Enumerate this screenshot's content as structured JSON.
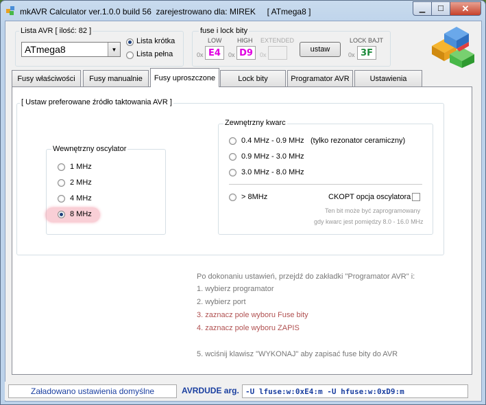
{
  "window": {
    "title": "mkAVR Calculator ver.1.0.0 build 56  zarejestrowano dla: MIREK     [ ATmega8 ]",
    "min_glyph": "▁",
    "max_glyph": "☐",
    "close_glyph": "✕"
  },
  "avr_list": {
    "group_label": "Lista AVR [ ilość: 82 ]",
    "selected": "ATmega8",
    "radio_short": "Lista krótka",
    "radio_full": "Lista pełna"
  },
  "fuse": {
    "group_label": "fuse i lock bity",
    "low_label": "LOW",
    "high_label": "HIGH",
    "extended_label": "EXTENDED",
    "lock_label": "LOCK BAJT",
    "prefix": "0x",
    "low_value": "E4",
    "high_value": "D9",
    "extended_value": "",
    "lock_value": "3F",
    "button_label": "ustaw",
    "low_color": "#e000e0",
    "high_color": "#e000e0",
    "lock_color": "#1c8a3a"
  },
  "tabs": [
    {
      "label": "Fusy właściwości"
    },
    {
      "label": "Fusy manualnie"
    },
    {
      "label": "Fusy uproszczone"
    },
    {
      "label": "Lock bity"
    },
    {
      "label": "Programator AVR"
    },
    {
      "label": "Ustawienia"
    }
  ],
  "panel": {
    "group_label": "[ Ustaw preferowane źródło taktowania AVR ]",
    "internal": {
      "label": "Wewnętrzny oscylator",
      "options": [
        "1 MHz",
        "2 MHz",
        "4 MHz",
        "8 MHz"
      ],
      "selected_index": 3
    },
    "external": {
      "label": "Zewnętrzny kwarc",
      "opt1": "0.4 MHz - 0.9 MHz",
      "opt1_note": "(tylko rezonator ceramiczny)",
      "opt2": "0.9 MHz - 3.0 MHz",
      "opt3": "3.0 MHz - 8.0 MHz",
      "opt4": "> 8MHz",
      "ckopt_label": "CKOPT opcja oscylatora",
      "note_line1": "Ten bit może być zaprogramowany",
      "note_line2": "gdy kwarc jest pomiędzy 8.0 - 16.0 MHz"
    },
    "instructions": {
      "intro": "Po dokonaniu ustawień, przejdź do zakładki \"Programator AVR\" i:",
      "step1": "1. wybierz programator",
      "step2": "2. wybierz port",
      "step3": "3. zaznacz pole wyboru Fuse bity",
      "step4": "4. zaznacz pole wyboru ZAPIS",
      "step5": "5. wciśnij klawisz \"WYKONAJ\" aby zapisać fuse bity do AVR"
    }
  },
  "status": {
    "message": "Załadowano ustawienia domyślne",
    "avrdude_label": "AVRDUDE arg.",
    "avrdude_value": "-U lfuse:w:0xE4:m  -U hfuse:w:0xD9:m"
  },
  "colors": {
    "highlight": "#f4a7b4",
    "instruction_red": "#b05050",
    "status_blue": "#1a3fa0"
  }
}
